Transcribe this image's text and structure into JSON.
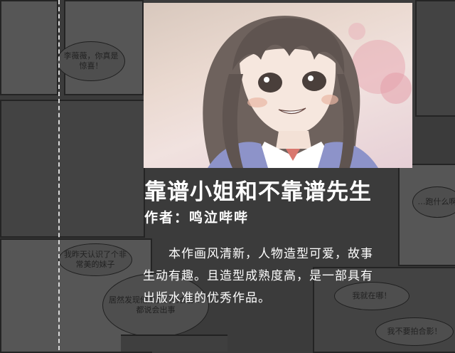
{
  "title": "靠谱小姐和不靠谱先生",
  "author_line": "作者：鸣泣哔哔",
  "description_lines": [
    "　　本作画风清新，人物造型可爱，故事",
    "生动有趣。且造型成熟度高，是一部具有",
    "出版水准的优秀作品。"
  ],
  "background_bubbles": [
    "李薇薇，你真是惊喜！",
    "…跑什么啊",
    "我昨天认识了个非常美的妹子",
    "居然发现他是我们的合影…都说会出事",
    "我就在哪！",
    "我不要拍合影！"
  ],
  "colors": {
    "background": "#3b3b3b",
    "text": "#ffffff",
    "divider": "#d9d9d9"
  }
}
